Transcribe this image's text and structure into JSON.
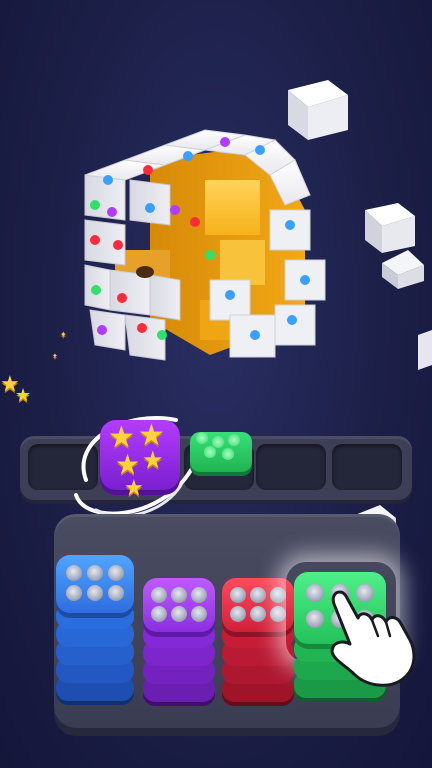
{
  "game": {
    "title": "",
    "stars_label": ""
  },
  "colors": {
    "background": "#1c1f47",
    "cube_white": "#f0f0f4",
    "cube_orange": "#f6b21a",
    "screw_blue": "#3aa0ff",
    "screw_purple": "#b13bff",
    "screw_red": "#ff2b3a",
    "screw_green": "#2fe06a",
    "stack_blue": "#2f6de0",
    "stack_purple": "#8a2fe0",
    "stack_red": "#d0203a",
    "stack_green": "#23c25a"
  },
  "slots": [
    {
      "state": "empty"
    },
    {
      "state": "purple-box-with-stars"
    },
    {
      "state": "green-screws"
    },
    {
      "state": "empty"
    },
    {
      "state": "empty"
    }
  ],
  "stacks": [
    {
      "color": "blue",
      "holes": 6,
      "layers": 7
    },
    {
      "color": "purple",
      "holes": 6,
      "layers": 5
    },
    {
      "color": "red",
      "holes": 6,
      "layers": 5
    },
    {
      "color": "green",
      "holes": 6,
      "layers": 4,
      "highlighted": true
    }
  ],
  "hint": {
    "icon": "pointing-hand-icon"
  }
}
